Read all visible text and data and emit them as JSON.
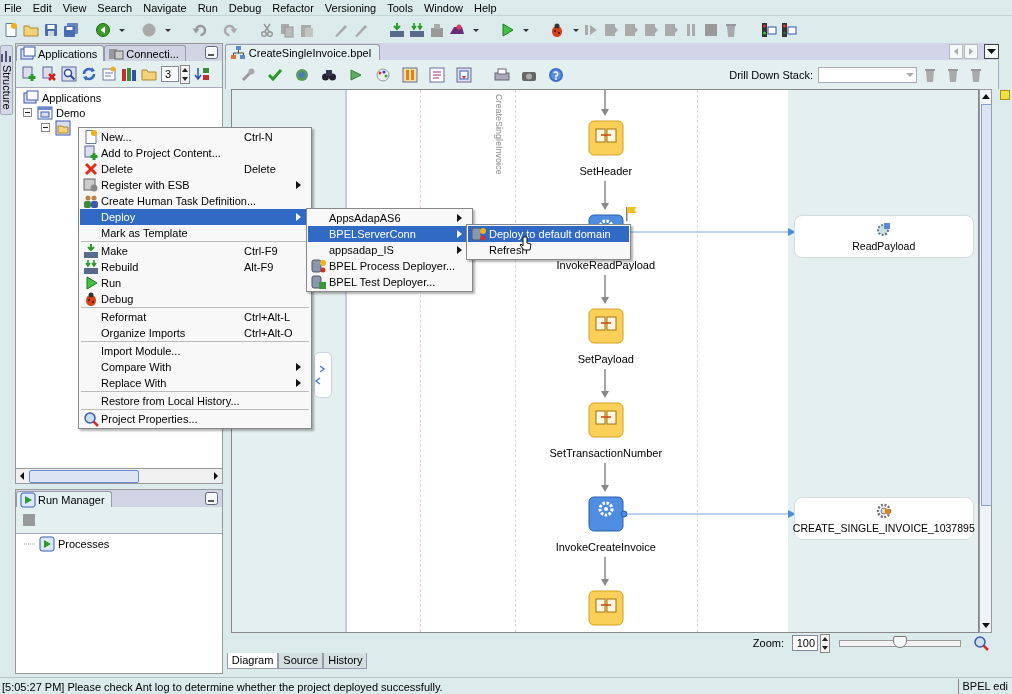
{
  "menubar": [
    "File",
    "Edit",
    "View",
    "Search",
    "Navigate",
    "Run",
    "Debug",
    "Refactor",
    "Versioning",
    "Tools",
    "Window",
    "Help"
  ],
  "side_strip": {
    "label": "Structure"
  },
  "applications_panel": {
    "tabs": [
      {
        "label": "Applications",
        "selected": true
      },
      {
        "label": "Connecti...",
        "selected": false
      }
    ],
    "level_value": "3",
    "tree": [
      {
        "label": "Applications",
        "children": [
          {
            "label": "Demo",
            "expanded": true,
            "children": [
              {
                "expanded": true
              }
            ]
          }
        ]
      }
    ]
  },
  "run_manager": {
    "tab": {
      "label": "Run Manager",
      "selected": true
    },
    "tree": [
      {
        "label": "Processes"
      }
    ]
  },
  "editor": {
    "tabs": [
      {
        "label": "CreateSingleInvoice.bpel",
        "selected": true
      }
    ],
    "drill_down": {
      "label": "Drill Down Stack:"
    },
    "lane_title": "CreateSingleInvoice",
    "activities": [
      {
        "kind": "assign",
        "label": "SetHeader",
        "flagged": false
      },
      {
        "kind": "invoke",
        "label": "InvokeReadPayload",
        "flagged": true
      },
      {
        "kind": "assign",
        "label": "SetPayload",
        "flagged": false
      },
      {
        "kind": "assign",
        "label": "SetTransactionNumber",
        "flagged": false
      },
      {
        "kind": "invoke",
        "label": "InvokeCreateInvoice",
        "flagged": false
      },
      {
        "kind": "assign",
        "flagged": false
      }
    ],
    "partner_links": [
      {
        "label": "ReadPayload"
      },
      {
        "label": "CREATE_SINGLE_INVOICE_1037895"
      }
    ],
    "zoom": {
      "label": "Zoom:",
      "value": "100",
      "slider": {
        "level": 0.5
      }
    },
    "view_tabs": [
      {
        "label": "Diagram",
        "selected": true
      },
      {
        "label": "Source",
        "selected": false
      },
      {
        "label": "History",
        "selected": false
      }
    ]
  },
  "context_menu": {
    "items": [
      {
        "kind": "item",
        "label": "New...",
        "shortcut": "Ctrl-N",
        "submenu": false,
        "selected": false
      },
      {
        "kind": "item",
        "label": "Add to Project Content...",
        "submenu": false,
        "selected": false
      },
      {
        "kind": "item",
        "label": "Delete",
        "shortcut": "Delete",
        "submenu": false,
        "selected": false
      },
      {
        "kind": "item",
        "label": "Register with ESB",
        "submenu": true,
        "selected": false
      },
      {
        "kind": "item",
        "label": "Create Human Task Definition...",
        "submenu": false,
        "selected": false
      },
      {
        "kind": "item",
        "label": "Deploy",
        "submenu": true,
        "selected": true
      },
      {
        "kind": "item",
        "label": "Mark as Template",
        "submenu": false,
        "selected": false
      },
      {
        "kind": "separator"
      },
      {
        "kind": "item",
        "label": "Make",
        "shortcut": "Ctrl-F9",
        "submenu": false,
        "selected": false
      },
      {
        "kind": "item",
        "label": "Rebuild",
        "shortcut": "Alt-F9",
        "submenu": false,
        "selected": false
      },
      {
        "kind": "item",
        "label": "Run",
        "submenu": false,
        "selected": false
      },
      {
        "kind": "item",
        "label": "Debug",
        "submenu": false,
        "selected": false
      },
      {
        "kind": "separator"
      },
      {
        "kind": "item",
        "label": "Reformat",
        "shortcut": "Ctrl+Alt-L",
        "submenu": false,
        "selected": false
      },
      {
        "kind": "item",
        "label": "Organize Imports",
        "shortcut": "Ctrl+Alt-O",
        "submenu": false,
        "selected": false
      },
      {
        "kind": "separator"
      },
      {
        "kind": "item",
        "label": "Import Module...",
        "submenu": false,
        "selected": false
      },
      {
        "kind": "item",
        "label": "Compare With",
        "submenu": true,
        "selected": false
      },
      {
        "kind": "item",
        "label": "Replace With",
        "submenu": true,
        "selected": false
      },
      {
        "kind": "separator"
      },
      {
        "kind": "item",
        "label": "Restore from Local History...",
        "submenu": false,
        "selected": false
      },
      {
        "kind": "separator"
      },
      {
        "kind": "item",
        "label": "Project Properties...",
        "submenu": false,
        "selected": false
      }
    ]
  },
  "deploy_submenu": {
    "items": [
      {
        "kind": "item",
        "label": "AppsAdapAS6",
        "submenu": true,
        "selected": false
      },
      {
        "kind": "item",
        "label": "BPELServerConn",
        "submenu": true,
        "selected": true
      },
      {
        "kind": "item",
        "label": "appsadap_IS",
        "submenu": true,
        "selected": false
      },
      {
        "kind": "item",
        "label": "BPEL Process Deployer...",
        "submenu": false,
        "selected": false
      },
      {
        "kind": "item",
        "label": "BPEL Test Deployer...",
        "submenu": false,
        "selected": false
      }
    ]
  },
  "connection_submenu": {
    "items": [
      {
        "kind": "item",
        "label": "Deploy to default domain",
        "submenu": false,
        "selected": true
      },
      {
        "kind": "item",
        "label": "Refresh",
        "submenu": false,
        "selected": false
      }
    ]
  },
  "status_bar": {
    "message": "[5:05:27 PM] Please check Ant log to determine whether the project deployed successfully.",
    "mode": "BPEL edi"
  }
}
